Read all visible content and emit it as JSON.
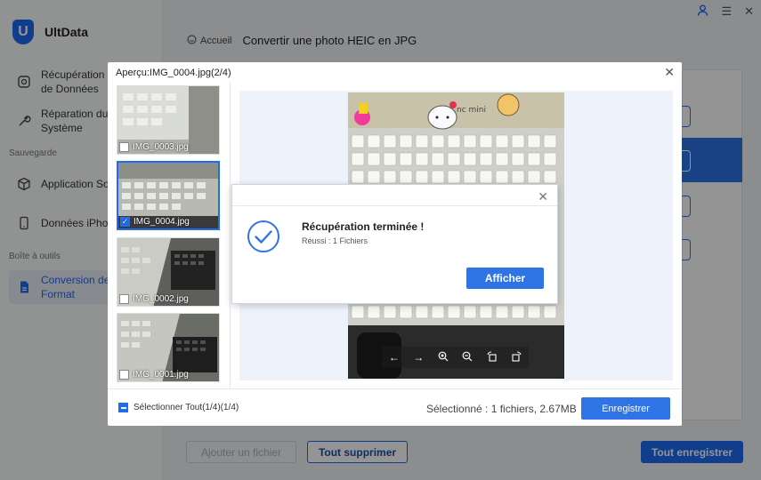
{
  "app": {
    "name": "UltData",
    "logo_letter": "U"
  },
  "topbar": {
    "icons": [
      "user-icon",
      "menu-icon",
      "close-icon"
    ]
  },
  "sidebar": {
    "items": [
      {
        "label": "Récupération\nde Données",
        "icon": "restore-icon"
      },
      {
        "label": "Réparation du\nSystème",
        "icon": "wrench-icon"
      },
      {
        "label": "Application So",
        "icon": "cube-icon"
      },
      {
        "label": "Données iPhon",
        "icon": "phone-icon"
      },
      {
        "label": "Conversion de\nFormat",
        "icon": "file-convert-icon"
      }
    ],
    "sections": {
      "backup": "Sauvegarde",
      "tools": "Boîte à outils"
    }
  },
  "breadcrumb": {
    "home": "Accueil",
    "title": "Convertir une photo HEIC en JPG"
  },
  "bottom": {
    "add_file": "Ajouter un fichier",
    "delete_all": "Tout supprimer",
    "save_all": "Tout enregistrer"
  },
  "preview": {
    "title": "Aperçu:IMG_0004.jpg(2/4)",
    "thumbnails": [
      {
        "name": "IMG_0003.jpg",
        "checked": false
      },
      {
        "name": "IMG_0004.jpg",
        "checked": true
      },
      {
        "name": "IMG_0002.jpg",
        "checked": false
      },
      {
        "name": "IMG_0001.jpg",
        "checked": false
      }
    ],
    "select_all": "Sélectionner Tout(1/4)(1/4)",
    "selected_info": "Sélectionné : 1 fichiers, 2.67MB",
    "save_button": "Enregistrer",
    "photo_text": "nc mini"
  },
  "success": {
    "title": "Récupération terminée !",
    "subtitle": "Réussi : 1 Fichiers",
    "button": "Afficher"
  },
  "colors": {
    "accent": "#1d6cf2",
    "button": "#2e74e6"
  }
}
